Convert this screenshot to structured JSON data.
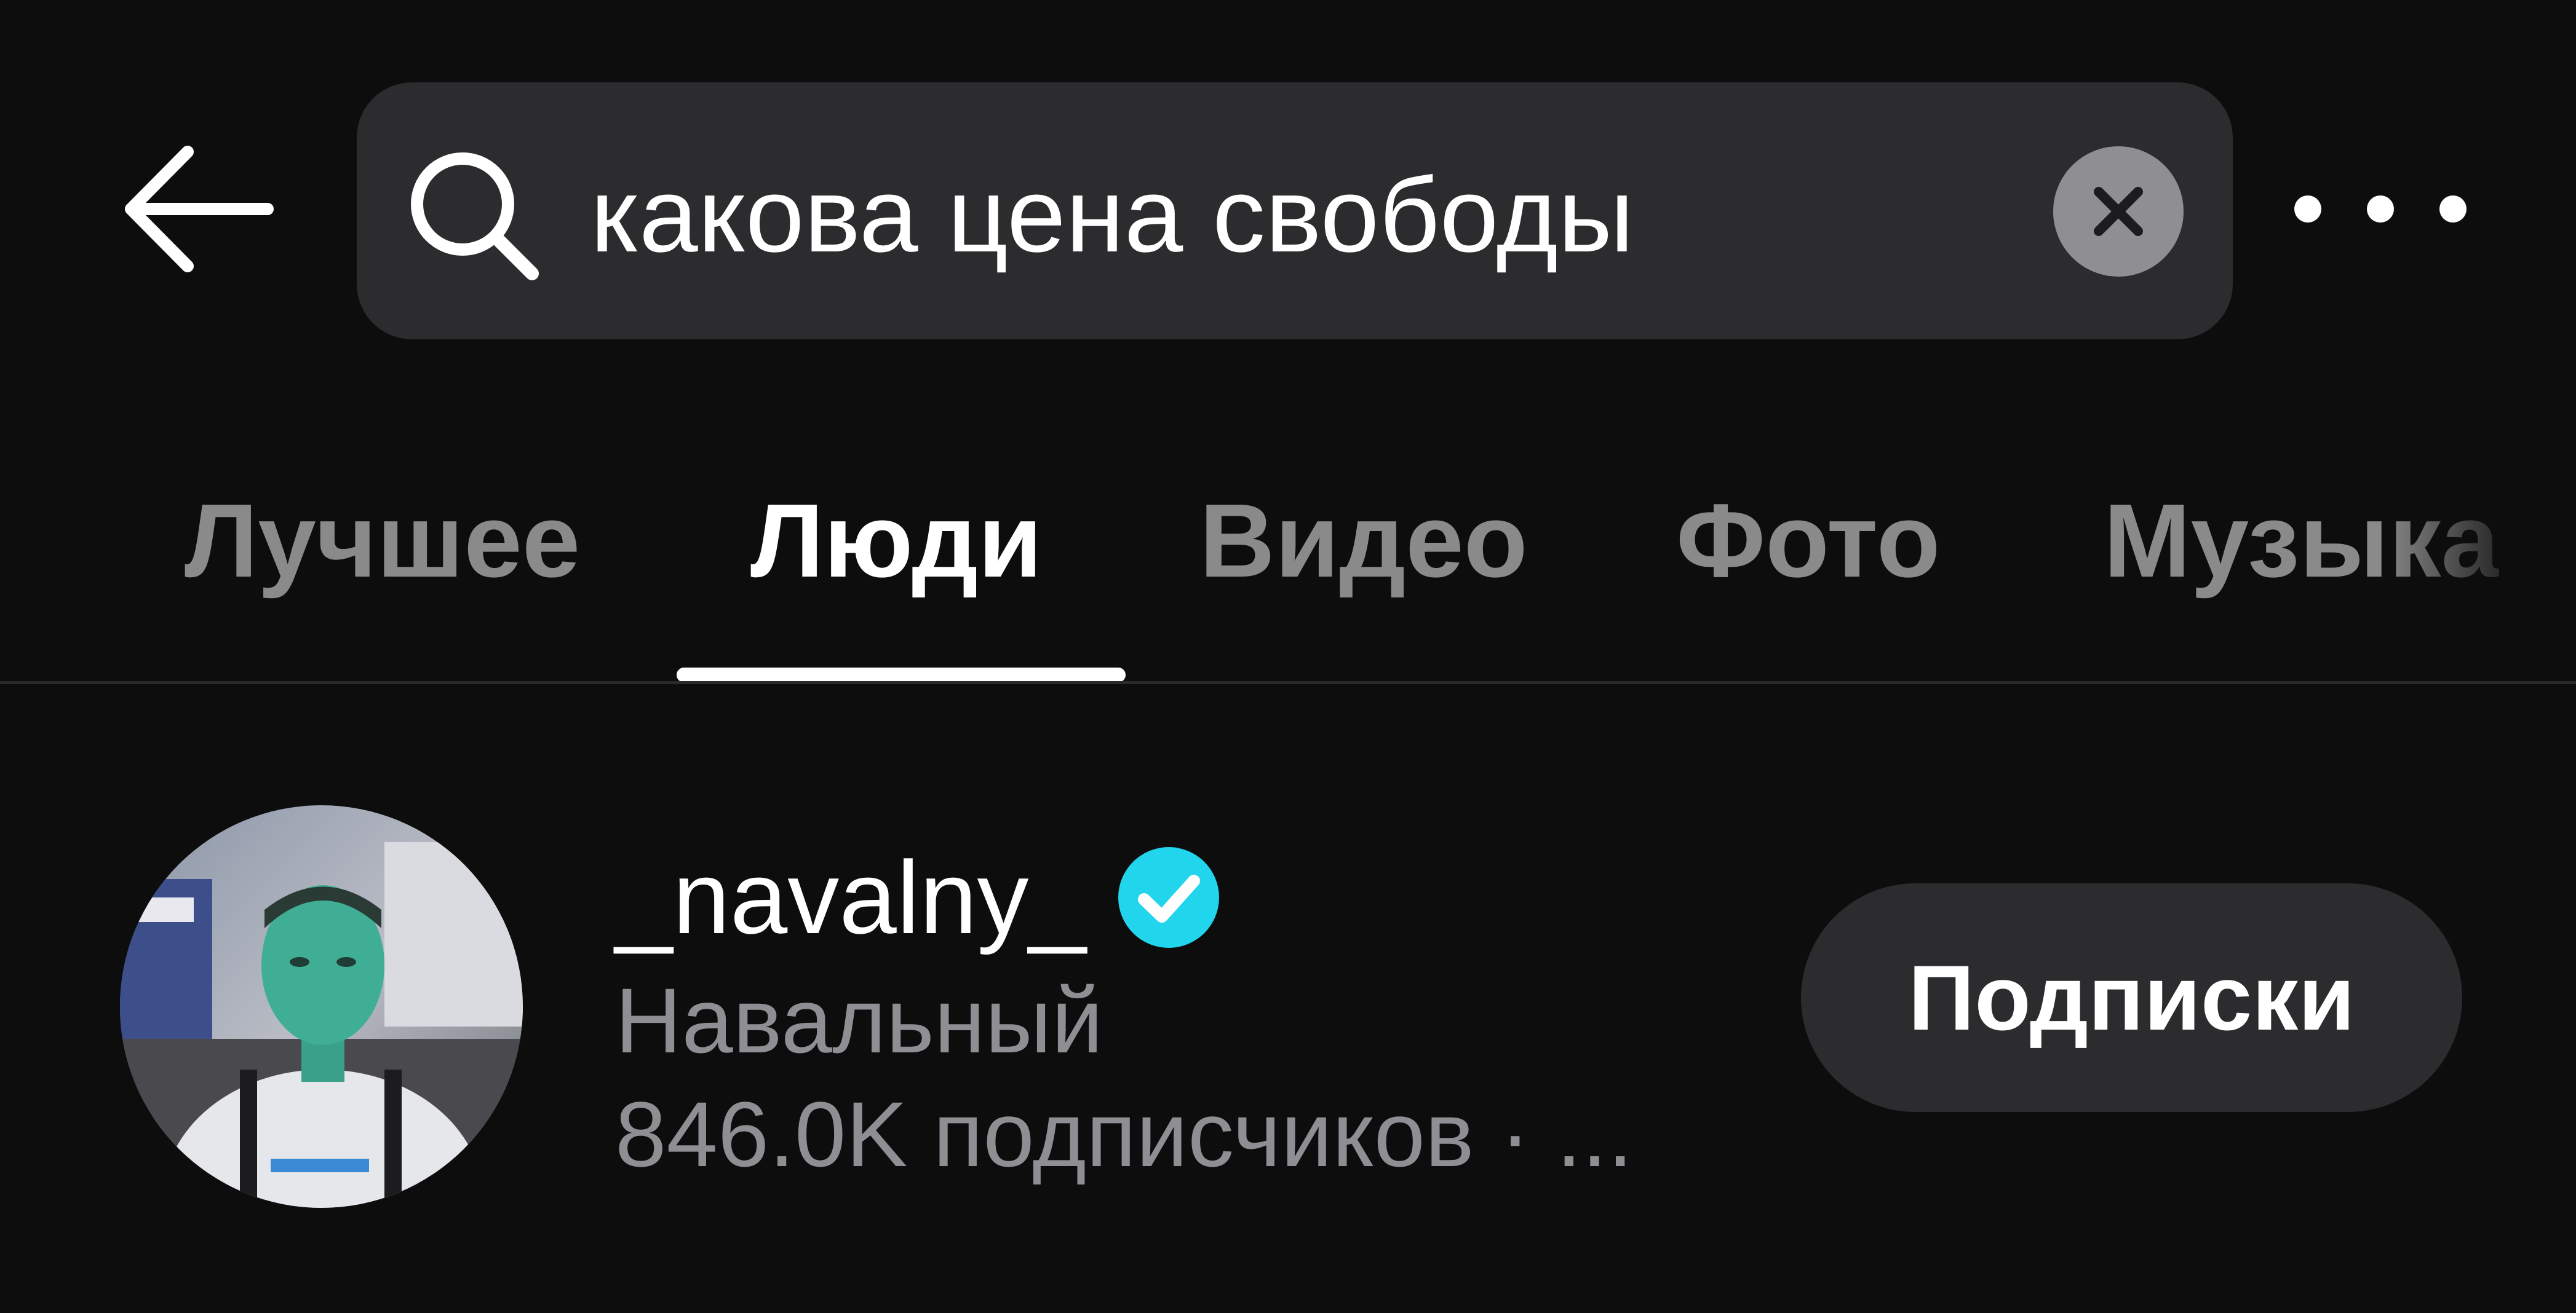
{
  "header": {
    "back_icon": "arrow-left-icon",
    "more_icon": "more-horizontal-icon"
  },
  "search": {
    "icon": "search-icon",
    "value": "какова цена свободы",
    "clear_icon": "close-circle-icon"
  },
  "tabs": [
    {
      "label": "Лучшее",
      "active": false
    },
    {
      "label": "Люди",
      "active": true
    },
    {
      "label": "Видео",
      "active": false
    },
    {
      "label": "Фото",
      "active": false
    },
    {
      "label": "Музыка",
      "active": false
    }
  ],
  "results": [
    {
      "username": "_navalny_",
      "verified": true,
      "display_name": "Навальный",
      "followers_text": "846.0K подписчиков · ...",
      "button_label": "Подписки"
    }
  ],
  "colors": {
    "background": "#0d0d0e",
    "search_bg": "#2c2c2e",
    "muted_text": "#8e8e93",
    "inactive_tab": "#8a8a8a",
    "verified_badge": "#20d5ec"
  }
}
